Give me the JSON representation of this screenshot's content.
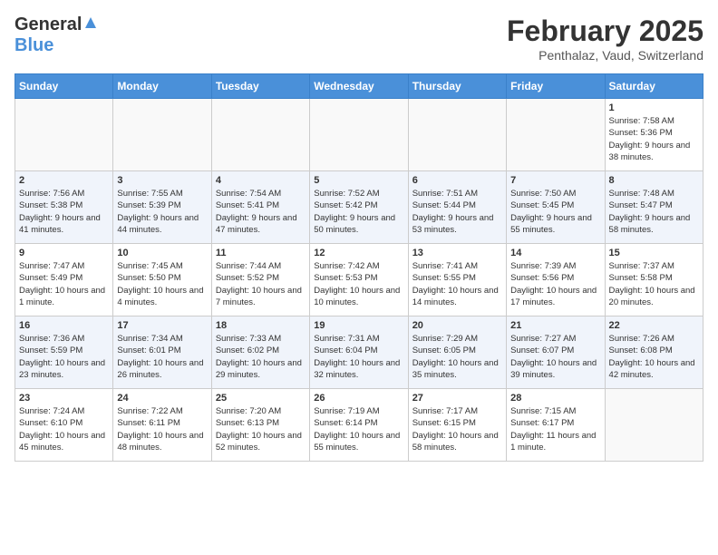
{
  "header": {
    "logo_general": "General",
    "logo_blue": "Blue",
    "title": "February 2025",
    "subtitle": "Penthalaz, Vaud, Switzerland"
  },
  "weekdays": [
    "Sunday",
    "Monday",
    "Tuesday",
    "Wednesday",
    "Thursday",
    "Friday",
    "Saturday"
  ],
  "weeks": [
    [
      {
        "day": "",
        "info": ""
      },
      {
        "day": "",
        "info": ""
      },
      {
        "day": "",
        "info": ""
      },
      {
        "day": "",
        "info": ""
      },
      {
        "day": "",
        "info": ""
      },
      {
        "day": "",
        "info": ""
      },
      {
        "day": "1",
        "info": "Sunrise: 7:58 AM\nSunset: 5:36 PM\nDaylight: 9 hours and 38 minutes."
      }
    ],
    [
      {
        "day": "2",
        "info": "Sunrise: 7:56 AM\nSunset: 5:38 PM\nDaylight: 9 hours and 41 minutes."
      },
      {
        "day": "3",
        "info": "Sunrise: 7:55 AM\nSunset: 5:39 PM\nDaylight: 9 hours and 44 minutes."
      },
      {
        "day": "4",
        "info": "Sunrise: 7:54 AM\nSunset: 5:41 PM\nDaylight: 9 hours and 47 minutes."
      },
      {
        "day": "5",
        "info": "Sunrise: 7:52 AM\nSunset: 5:42 PM\nDaylight: 9 hours and 50 minutes."
      },
      {
        "day": "6",
        "info": "Sunrise: 7:51 AM\nSunset: 5:44 PM\nDaylight: 9 hours and 53 minutes."
      },
      {
        "day": "7",
        "info": "Sunrise: 7:50 AM\nSunset: 5:45 PM\nDaylight: 9 hours and 55 minutes."
      },
      {
        "day": "8",
        "info": "Sunrise: 7:48 AM\nSunset: 5:47 PM\nDaylight: 9 hours and 58 minutes."
      }
    ],
    [
      {
        "day": "9",
        "info": "Sunrise: 7:47 AM\nSunset: 5:49 PM\nDaylight: 10 hours and 1 minute."
      },
      {
        "day": "10",
        "info": "Sunrise: 7:45 AM\nSunset: 5:50 PM\nDaylight: 10 hours and 4 minutes."
      },
      {
        "day": "11",
        "info": "Sunrise: 7:44 AM\nSunset: 5:52 PM\nDaylight: 10 hours and 7 minutes."
      },
      {
        "day": "12",
        "info": "Sunrise: 7:42 AM\nSunset: 5:53 PM\nDaylight: 10 hours and 10 minutes."
      },
      {
        "day": "13",
        "info": "Sunrise: 7:41 AM\nSunset: 5:55 PM\nDaylight: 10 hours and 14 minutes."
      },
      {
        "day": "14",
        "info": "Sunrise: 7:39 AM\nSunset: 5:56 PM\nDaylight: 10 hours and 17 minutes."
      },
      {
        "day": "15",
        "info": "Sunrise: 7:37 AM\nSunset: 5:58 PM\nDaylight: 10 hours and 20 minutes."
      }
    ],
    [
      {
        "day": "16",
        "info": "Sunrise: 7:36 AM\nSunset: 5:59 PM\nDaylight: 10 hours and 23 minutes."
      },
      {
        "day": "17",
        "info": "Sunrise: 7:34 AM\nSunset: 6:01 PM\nDaylight: 10 hours and 26 minutes."
      },
      {
        "day": "18",
        "info": "Sunrise: 7:33 AM\nSunset: 6:02 PM\nDaylight: 10 hours and 29 minutes."
      },
      {
        "day": "19",
        "info": "Sunrise: 7:31 AM\nSunset: 6:04 PM\nDaylight: 10 hours and 32 minutes."
      },
      {
        "day": "20",
        "info": "Sunrise: 7:29 AM\nSunset: 6:05 PM\nDaylight: 10 hours and 35 minutes."
      },
      {
        "day": "21",
        "info": "Sunrise: 7:27 AM\nSunset: 6:07 PM\nDaylight: 10 hours and 39 minutes."
      },
      {
        "day": "22",
        "info": "Sunrise: 7:26 AM\nSunset: 6:08 PM\nDaylight: 10 hours and 42 minutes."
      }
    ],
    [
      {
        "day": "23",
        "info": "Sunrise: 7:24 AM\nSunset: 6:10 PM\nDaylight: 10 hours and 45 minutes."
      },
      {
        "day": "24",
        "info": "Sunrise: 7:22 AM\nSunset: 6:11 PM\nDaylight: 10 hours and 48 minutes."
      },
      {
        "day": "25",
        "info": "Sunrise: 7:20 AM\nSunset: 6:13 PM\nDaylight: 10 hours and 52 minutes."
      },
      {
        "day": "26",
        "info": "Sunrise: 7:19 AM\nSunset: 6:14 PM\nDaylight: 10 hours and 55 minutes."
      },
      {
        "day": "27",
        "info": "Sunrise: 7:17 AM\nSunset: 6:15 PM\nDaylight: 10 hours and 58 minutes."
      },
      {
        "day": "28",
        "info": "Sunrise: 7:15 AM\nSunset: 6:17 PM\nDaylight: 11 hours and 1 minute."
      },
      {
        "day": "",
        "info": ""
      }
    ]
  ]
}
